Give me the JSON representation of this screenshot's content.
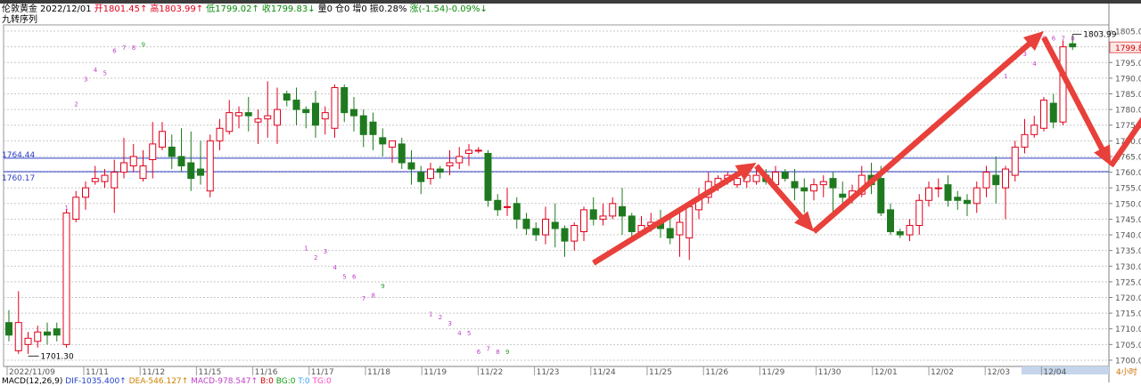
{
  "header": {
    "symbol": "伦敦黄金",
    "date": "2022/12/01",
    "open": "开1801.45↑",
    "high": "高1803.99↑",
    "low": "低1799.02↑",
    "close": "收1799.83↓",
    "volume": "量0",
    "position": "仓0",
    "pos_change": "增0",
    "amplitude": "振0.28%",
    "change": "涨(-1.54)-0.09%↓",
    "indicator": "九转序列"
  },
  "macd_line": {
    "name": "MACD(12,26,9)",
    "dif": "DIF-1035.400↑",
    "dea": "DEA-546.127↑",
    "macd": "MACD-978.547↑",
    "b": "B:0",
    "bg": "BG:0",
    "t": "T:0",
    "tg": "TG:0"
  },
  "colors": {
    "up": "#e0001b",
    "down": "#1f7a1f",
    "arrow": "#e8403a",
    "hline": "#2f3fc8",
    "grid": "#c8c8c8"
  },
  "chart_data": {
    "type": "candlestick",
    "ylim": [
      1698,
      1807
    ],
    "ytick_step": 5,
    "ytick_labels": [
      "1700.00",
      "1705.00",
      "1710.00",
      "1715.00",
      "1720.00",
      "1725.00",
      "1730.00",
      "1735.00",
      "1740.00",
      "1745.00",
      "1750.00",
      "1755.00",
      "1760.00",
      "1765.00",
      "1770.00",
      "1775.00",
      "1780.00",
      "1785.00",
      "1790.00",
      "1795.00",
      "1800.00",
      "1805.00"
    ],
    "current_price": "1799.83",
    "levels": [
      1764.44,
      1760.17
    ],
    "level_labels": [
      "1764.44",
      "1760.17"
    ],
    "high_mark": "1803.99",
    "low_mark": "1701.30",
    "xlabels": [
      "2022/11/09",
      "11/11",
      "11/12",
      "11/15",
      "11/16",
      "11/17",
      "11/18",
      "11/19",
      "11/22",
      "11/23",
      "11/24",
      "11/25",
      "11/26",
      "11/29",
      "11/30",
      "12/01",
      "12/02",
      "12/03",
      "12/04"
    ],
    "xaxis_right_label": "4小时",
    "candles": [
      [
        1712,
        1708,
        1716,
        1706
      ],
      [
        1703,
        1712,
        1722,
        1702
      ],
      [
        1705,
        1707,
        1709,
        1702
      ],
      [
        1706,
        1709,
        1711,
        1704
      ],
      [
        1709,
        1708,
        1712,
        1705
      ],
      [
        1710,
        1708,
        1712,
        1706
      ],
      [
        1705,
        1747,
        1748,
        1704
      ],
      [
        1745,
        1752,
        1754,
        1744
      ],
      [
        1752,
        1755,
        1757,
        1748
      ],
      [
        1757,
        1758,
        1762,
        1756
      ],
      [
        1757,
        1759,
        1761,
        1755
      ],
      [
        1755,
        1760,
        1764,
        1747
      ],
      [
        1760,
        1763,
        1771,
        1758
      ],
      [
        1762,
        1765,
        1769,
        1760
      ],
      [
        1758,
        1762,
        1767,
        1757
      ],
      [
        1764,
        1769,
        1776,
        1758
      ],
      [
        1768,
        1773,
        1776,
        1767
      ],
      [
        1768,
        1765,
        1772,
        1761
      ],
      [
        1765,
        1762,
        1774,
        1760
      ],
      [
        1763,
        1758,
        1773,
        1754
      ],
      [
        1761,
        1759,
        1770,
        1756
      ],
      [
        1754,
        1770,
        1772,
        1752
      ],
      [
        1770,
        1774,
        1777,
        1767
      ],
      [
        1773,
        1779,
        1783,
        1772
      ],
      [
        1778,
        1779,
        1781,
        1774
      ],
      [
        1779,
        1778,
        1784,
        1773
      ],
      [
        1776,
        1777,
        1780,
        1769
      ],
      [
        1777,
        1778,
        1789,
        1771
      ],
      [
        1775,
        1780,
        1787,
        1769
      ],
      [
        1785,
        1783,
        1786,
        1781
      ],
      [
        1783,
        1780,
        1787,
        1775
      ],
      [
        1780,
        1779,
        1781,
        1774
      ],
      [
        1782,
        1775,
        1786,
        1771
      ],
      [
        1777,
        1779,
        1781,
        1772
      ],
      [
        1774,
        1787,
        1788,
        1771
      ],
      [
        1787,
        1779,
        1788,
        1776
      ],
      [
        1780,
        1778,
        1784,
        1773
      ],
      [
        1778,
        1772,
        1780,
        1768
      ],
      [
        1776,
        1772,
        1779,
        1767
      ],
      [
        1771,
        1769,
        1774,
        1765
      ],
      [
        1768,
        1770,
        1770,
        1763
      ],
      [
        1769,
        1763,
        1771,
        1761
      ],
      [
        1763,
        1761,
        1767,
        1756
      ],
      [
        1760,
        1757,
        1762,
        1753
      ],
      [
        1758,
        1761,
        1763,
        1756
      ],
      [
        1761,
        1760,
        1762,
        1758
      ],
      [
        1762,
        1763,
        1767,
        1759
      ],
      [
        1763,
        1765,
        1768,
        1761
      ],
      [
        1766,
        1767,
        1769,
        1762
      ],
      [
        1767,
        1767,
        1768,
        1766
      ],
      [
        1766,
        1751,
        1767,
        1749
      ],
      [
        1751,
        1748,
        1753,
        1746
      ],
      [
        1749,
        1749,
        1755,
        1746
      ],
      [
        1750,
        1745,
        1752,
        1742
      ],
      [
        1745,
        1742,
        1747,
        1740
      ],
      [
        1742,
        1740,
        1744,
        1738
      ],
      [
        1740,
        1745,
        1749,
        1737
      ],
      [
        1744,
        1742,
        1750,
        1736
      ],
      [
        1742,
        1738,
        1743,
        1733
      ],
      [
        1738,
        1743,
        1744,
        1735
      ],
      [
        1741,
        1748,
        1749,
        1738
      ],
      [
        1748,
        1745,
        1752,
        1743
      ],
      [
        1745,
        1746,
        1750,
        1743
      ],
      [
        1746,
        1750,
        1752,
        1745
      ],
      [
        1749,
        1746,
        1755,
        1740
      ],
      [
        1746,
        1741,
        1747,
        1738
      ],
      [
        1741,
        1743,
        1746,
        1740
      ],
      [
        1743,
        1744,
        1747,
        1741
      ],
      [
        1744,
        1742,
        1748,
        1739
      ],
      [
        1742,
        1739,
        1745,
        1737
      ],
      [
        1740,
        1744,
        1748,
        1733
      ],
      [
        1739,
        1749,
        1750,
        1732
      ],
      [
        1748,
        1752,
        1755,
        1745
      ],
      [
        1752,
        1757,
        1760,
        1750
      ],
      [
        1756,
        1758,
        1759,
        1754
      ],
      [
        1758,
        1759,
        1760,
        1756
      ],
      [
        1756,
        1758,
        1759,
        1755
      ],
      [
        1757,
        1759,
        1759,
        1755
      ],
      [
        1757,
        1759,
        1761,
        1756
      ],
      [
        1759,
        1757,
        1761,
        1756
      ],
      [
        1756,
        1760,
        1762,
        1755
      ],
      [
        1760,
        1758,
        1761,
        1757
      ],
      [
        1757,
        1755,
        1761,
        1751
      ],
      [
        1755,
        1754,
        1758,
        1747
      ],
      [
        1754,
        1756,
        1758,
        1751
      ],
      [
        1756,
        1757,
        1759,
        1752
      ],
      [
        1758,
        1755,
        1760,
        1747
      ],
      [
        1753,
        1752,
        1757,
        1750
      ],
      [
        1752,
        1754,
        1756,
        1750
      ],
      [
        1753,
        1759,
        1762,
        1752
      ],
      [
        1759,
        1756,
        1763,
        1753
      ],
      [
        1758,
        1747,
        1762,
        1746
      ],
      [
        1748,
        1741,
        1750,
        1740
      ],
      [
        1741,
        1740,
        1742,
        1739
      ],
      [
        1740,
        1743,
        1745,
        1738
      ],
      [
        1743,
        1751,
        1753,
        1740
      ],
      [
        1751,
        1755,
        1757,
        1749
      ],
      [
        1755,
        1755,
        1758,
        1752
      ],
      [
        1756,
        1751,
        1759,
        1749
      ],
      [
        1752,
        1751,
        1754,
        1748
      ],
      [
        1751,
        1750,
        1753,
        1746
      ],
      [
        1750,
        1755,
        1757,
        1747
      ],
      [
        1755,
        1760,
        1762,
        1752
      ],
      [
        1759,
        1756,
        1765,
        1750
      ],
      [
        1755,
        1761,
        1762,
        1745
      ],
      [
        1759,
        1768,
        1770,
        1757
      ],
      [
        1768,
        1772,
        1777,
        1766
      ],
      [
        1772,
        1775,
        1778,
        1771
      ],
      [
        1774,
        1783,
        1784,
        1773
      ],
      [
        1782,
        1776,
        1785,
        1774
      ],
      [
        1776,
        1800,
        1802,
        1775
      ],
      [
        1801,
        1800,
        1804,
        1799
      ]
    ],
    "annotations": [
      {
        "t": "1",
        "i": 6,
        "p": 1748,
        "c": "#c040c8"
      },
      {
        "t": "2",
        "i": 7,
        "p": 1781,
        "c": "#c040c8"
      },
      {
        "t": "3",
        "i": 8,
        "p": 1789,
        "c": "#c040c8"
      },
      {
        "t": "4",
        "i": 9,
        "p": 1792,
        "c": "#c040c8"
      },
      {
        "t": "5",
        "i": 10,
        "p": 1791,
        "c": "#c040c8"
      },
      {
        "t": "6",
        "i": 11,
        "p": 1798,
        "c": "#c040c8"
      },
      {
        "t": "7",
        "i": 12,
        "p": 1799,
        "c": "#c040c8"
      },
      {
        "t": "8",
        "i": 13,
        "p": 1799,
        "c": "#c040c8"
      },
      {
        "t": "9",
        "i": 14,
        "p": 1800,
        "c": "#2aa02a"
      },
      {
        "t": "1",
        "i": 31,
        "p": 1735,
        "c": "#c040c8"
      },
      {
        "t": "2",
        "i": 32,
        "p": 1732,
        "c": "#c040c8"
      },
      {
        "t": "3",
        "i": 33,
        "p": 1734,
        "c": "#c040c8"
      },
      {
        "t": "4",
        "i": 34,
        "p": 1729,
        "c": "#c040c8"
      },
      {
        "t": "5",
        "i": 35,
        "p": 1726,
        "c": "#c040c8"
      },
      {
        "t": "6",
        "i": 36,
        "p": 1726,
        "c": "#c040c8"
      },
      {
        "t": "7",
        "i": 37,
        "p": 1719,
        "c": "#c040c8"
      },
      {
        "t": "8",
        "i": 38,
        "p": 1720,
        "c": "#c040c8"
      },
      {
        "t": "9",
        "i": 39,
        "p": 1723,
        "c": "#2aa02a"
      },
      {
        "t": "1",
        "i": 44,
        "p": 1714,
        "c": "#c040c8"
      },
      {
        "t": "2",
        "i": 45,
        "p": 1713,
        "c": "#c040c8"
      },
      {
        "t": "3",
        "i": 46,
        "p": 1711,
        "c": "#c040c8"
      },
      {
        "t": "4",
        "i": 47,
        "p": 1708,
        "c": "#c040c8"
      },
      {
        "t": "5",
        "i": 48,
        "p": 1708,
        "c": "#c040c8"
      },
      {
        "t": "6",
        "i": 49,
        "p": 1702,
        "c": "#c040c8"
      },
      {
        "t": "7",
        "i": 50,
        "p": 1703,
        "c": "#c040c8"
      },
      {
        "t": "8",
        "i": 51,
        "p": 1702,
        "c": "#c040c8"
      },
      {
        "t": "9",
        "i": 52,
        "p": 1702,
        "c": "#2aa02a"
      },
      {
        "t": "1",
        "i": 104,
        "p": 1790,
        "c": "#c040c8"
      },
      {
        "t": "2",
        "i": 105,
        "p": 1796,
        "c": "#c040c8"
      },
      {
        "t": "3",
        "i": 106,
        "p": 1797,
        "c": "#c040c8"
      },
      {
        "t": "4",
        "i": 107,
        "p": 1794,
        "c": "#c040c8"
      },
      {
        "t": "5",
        "i": 108,
        "p": 1802,
        "c": "#c040c8"
      },
      {
        "t": "6",
        "i": 109,
        "p": 1802,
        "c": "#c040c8"
      },
      {
        "t": "7",
        "i": 110,
        "p": 1802,
        "c": "#c040c8"
      },
      {
        "t": "8",
        "i": 111,
        "p": 1802,
        "c": "#c040c8"
      }
    ],
    "arrows": [
      {
        "from": [
          61,
          1731
        ],
        "to": [
          78,
          1763
        ]
      },
      {
        "from": [
          78,
          1762
        ],
        "to": [
          84,
          1741
        ]
      },
      {
        "from": [
          84,
          1741
        ],
        "to": [
          108,
          1805
        ]
      },
      {
        "from": [
          108,
          1803
        ],
        "to": [
          115,
          1762
        ]
      },
      {
        "from": [
          115,
          1762
        ],
        "to": [
          126,
          1811
        ]
      }
    ]
  }
}
